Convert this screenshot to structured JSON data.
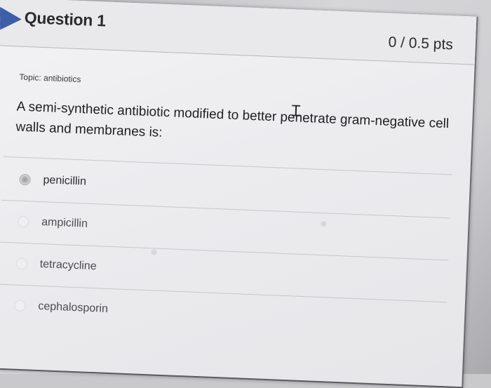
{
  "question": {
    "title": "Question 1",
    "points": "0 / 0.5 pts",
    "topic": "Topic: antibiotics",
    "text": "A semi-synthetic antibiotic modified to better penetrate gram-negative cell walls and membranes is:"
  },
  "options": [
    {
      "label": "penicillin"
    },
    {
      "label": "ampicillin"
    },
    {
      "label": "tetracycline"
    },
    {
      "label": "cephalosporin"
    }
  ],
  "colors": {
    "accent": "#3b5fa8",
    "text": "#2b2b2e"
  },
  "icons": {
    "cursor": "text-cursor-icon",
    "marker": "question-arrow-icon"
  }
}
